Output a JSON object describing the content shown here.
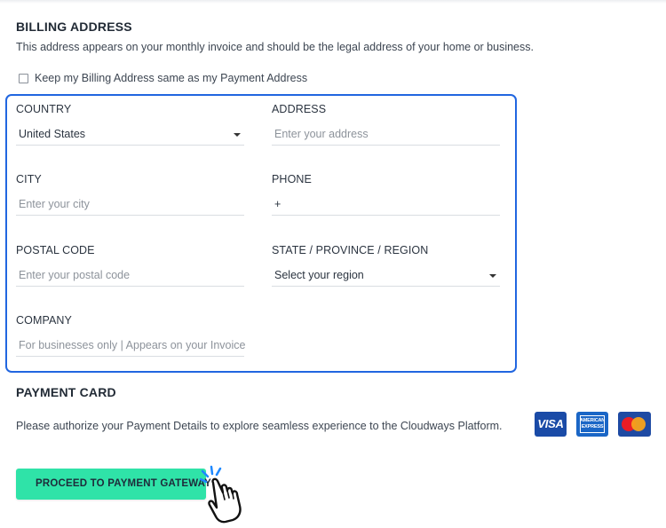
{
  "billing": {
    "title": "BILLING ADDRESS",
    "description": "This address appears on your monthly invoice and should be the legal address of your home or business.",
    "same_as_payment_label": "Keep my Billing Address same as my Payment Address",
    "same_as_payment_checked": false
  },
  "fields": {
    "country": {
      "label": "COUNTRY",
      "value": "United States"
    },
    "address": {
      "label": "ADDRESS",
      "placeholder": "Enter your address"
    },
    "city": {
      "label": "CITY",
      "placeholder": "Enter your city"
    },
    "phone": {
      "label": "PHONE",
      "value": "+"
    },
    "postal_code": {
      "label": "POSTAL CODE",
      "placeholder": "Enter your postal code"
    },
    "region": {
      "label": "STATE / PROVINCE / REGION",
      "value": "Select your region"
    },
    "company": {
      "label": "COMPANY",
      "placeholder": "For businesses only | Appears on your Invoice"
    }
  },
  "payment": {
    "title": "PAYMENT CARD",
    "description": "Please authorize your Payment Details to explore seamless experience to the Cloudways Platform.",
    "cards": {
      "visa": "VISA",
      "amex_line1": "AMERICAN",
      "amex_line2": "EXPRESS"
    },
    "proceed_label": "PROCEED TO PAYMENT GATEWAY"
  },
  "colors": {
    "accent_button": "#2fe3a8",
    "highlight_border": "#2166e0"
  },
  "icons": {
    "cursor": "hand-pointer-icon",
    "country_dropdown": "caret-down-icon",
    "region_dropdown": "caret-down-icon"
  }
}
